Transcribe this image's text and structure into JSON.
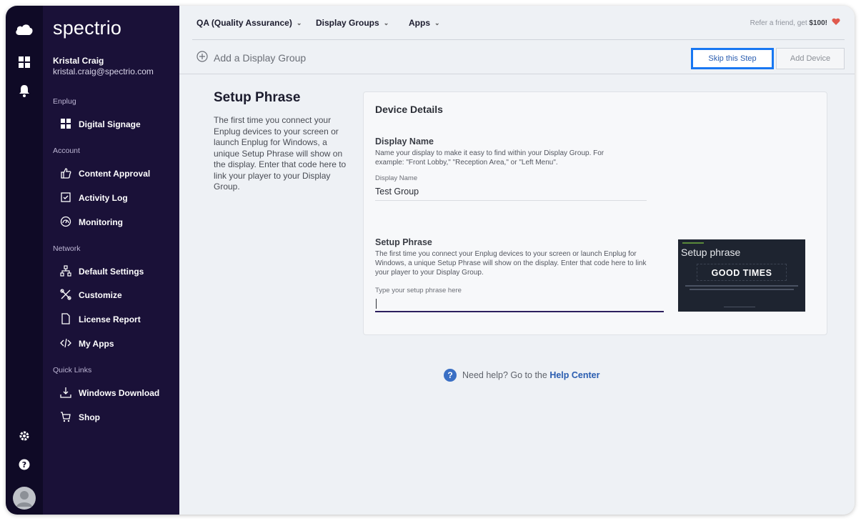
{
  "brand": {
    "logo_text": "spectrio"
  },
  "user": {
    "name": "Kristal Craig",
    "email": "kristal.craig@spectrio.com"
  },
  "sidebar": {
    "sections": [
      {
        "label": "Enplug",
        "items": [
          {
            "label": "Digital Signage",
            "icon": "grid-icon"
          }
        ]
      },
      {
        "label": "Account",
        "items": [
          {
            "label": "Content Approval",
            "icon": "thumbs-up-icon"
          },
          {
            "label": "Activity Log",
            "icon": "checkbox-icon"
          },
          {
            "label": "Monitoring",
            "icon": "gauge-icon"
          }
        ]
      },
      {
        "label": "Network",
        "items": [
          {
            "label": "Default Settings",
            "icon": "network-icon"
          },
          {
            "label": "Customize",
            "icon": "tools-icon"
          },
          {
            "label": "License Report",
            "icon": "document-icon"
          },
          {
            "label": "My Apps",
            "icon": "code-icon"
          }
        ]
      },
      {
        "label": "Quick Links",
        "items": [
          {
            "label": "Windows Download",
            "icon": "download-icon"
          },
          {
            "label": "Shop",
            "icon": "cart-icon"
          }
        ]
      }
    ]
  },
  "topbar": {
    "menus": [
      "QA (Quality Assurance)",
      "Display Groups",
      "Apps"
    ],
    "refer_text": "Refer a friend, get ",
    "refer_amount": "$100!"
  },
  "subbar": {
    "add_group_label": "Add a Display Group",
    "skip_label": "Skip this Step",
    "add_device_label": "Add Device"
  },
  "help_panel": {
    "title": "Setup Phrase",
    "text": "The first time you connect your Enplug devices to your screen or launch Enplug for Windows, a unique Setup Phrase will show on the display. Enter that code here to link your player to your Display Group."
  },
  "device_details": {
    "title": "Device Details",
    "display_name": {
      "title": "Display Name",
      "desc_line1": "Name your display to make it easy to find within your Display Group. For",
      "desc_line2": "example: \"Front Lobby,\" \"Reception Area,\" or \"Left Menu\".",
      "label": "Display Name",
      "value": "Test Group"
    },
    "setup_phrase": {
      "title": "Setup Phrase",
      "desc_line1": "The first time you connect your Enplug devices to your screen or launch Enplug for",
      "desc_line2": "Windows, a unique Setup Phrase will show on the display. Enter that code here to link",
      "desc_line3": "your player to your Display Group.",
      "label": "Type your setup phrase here",
      "value": ""
    },
    "preview": {
      "title": "Setup phrase",
      "code": "GOOD TIMES"
    }
  },
  "footer_help": {
    "text": "Need help? Go to the ",
    "link": "Help Center"
  },
  "colors": {
    "sidebar": "#1a1138",
    "rail": "#0f0a26",
    "accent": "#1877f2",
    "heart": "#e05a4e"
  }
}
